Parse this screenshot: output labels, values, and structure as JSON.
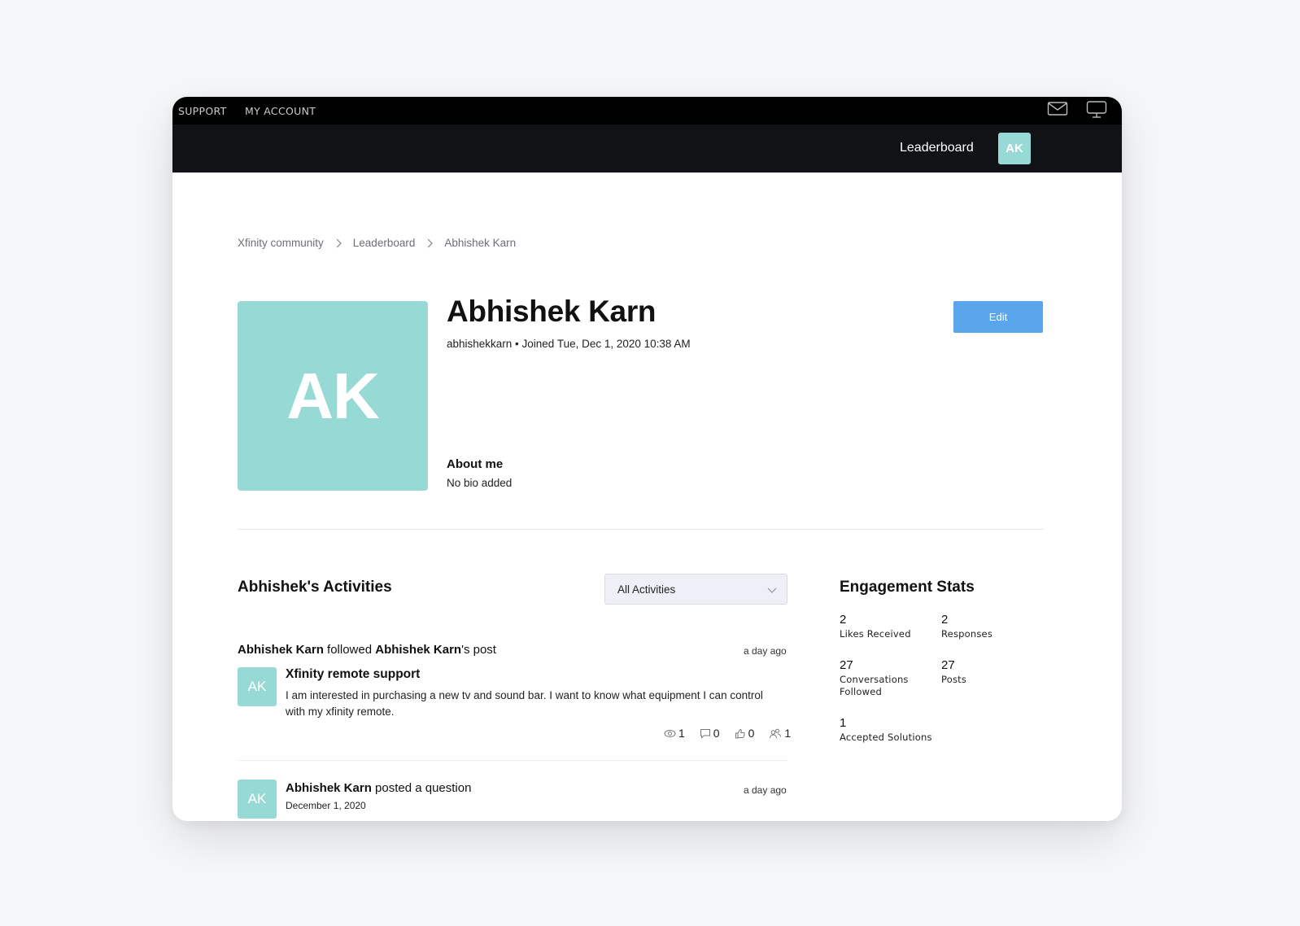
{
  "topbar": {
    "links": [
      {
        "label": "SUPPORT"
      },
      {
        "label": "MY ACCOUNT"
      }
    ],
    "icons": [
      "mail-icon",
      "monitor-icon"
    ]
  },
  "navbar": {
    "leaderboard_label": "Leaderboard",
    "avatar_initials": "AK"
  },
  "colors": {
    "avatar": "#96d9d5",
    "edit_button": "#5aa6ec",
    "topbar": "#000000",
    "navbar": "#111216"
  },
  "breadcrumb": [
    {
      "label": "Xfinity community"
    },
    {
      "label": "Leaderboard"
    },
    {
      "label": "Abhishek Karn"
    }
  ],
  "profile": {
    "initials": "AK",
    "name": "Abhishek Karn",
    "meta": "abhishekkarn • Joined Tue, Dec 1, 2020 10:38 AM",
    "edit_label": "Edit",
    "about_heading": "About me",
    "about_text": "No bio added"
  },
  "activities": {
    "heading": "Abhishek's Activities",
    "filter": {
      "selected": "All Activities"
    },
    "items": [
      {
        "actor": "Abhishek Karn",
        "verb": " followed ",
        "target": "Abhishek Karn",
        "suffix": "'s post",
        "time": "a day ago",
        "avatar_initials": "AK",
        "post_title": "Xfinity remote support",
        "post_body": "I am interested in purchasing a new tv and sound bar. I want to know what equipment I can control with my xfinity remote.",
        "counts": {
          "views": "1",
          "comments": "0",
          "likes": "0",
          "followers": "1"
        }
      },
      {
        "actor": "Abhishek Karn",
        "verb": " posted a question",
        "time": "a day ago",
        "avatar_initials": "AK",
        "date": "December 1, 2020"
      }
    ]
  },
  "engagement": {
    "heading": "Engagement Stats",
    "stats": [
      {
        "value": "2",
        "label": "Likes Received"
      },
      {
        "value": "2",
        "label": "Responses"
      },
      {
        "value": "27",
        "label": "Conversations Followed"
      },
      {
        "value": "27",
        "label": "Posts"
      },
      {
        "value": "1",
        "label": "Accepted Solutions"
      }
    ]
  }
}
